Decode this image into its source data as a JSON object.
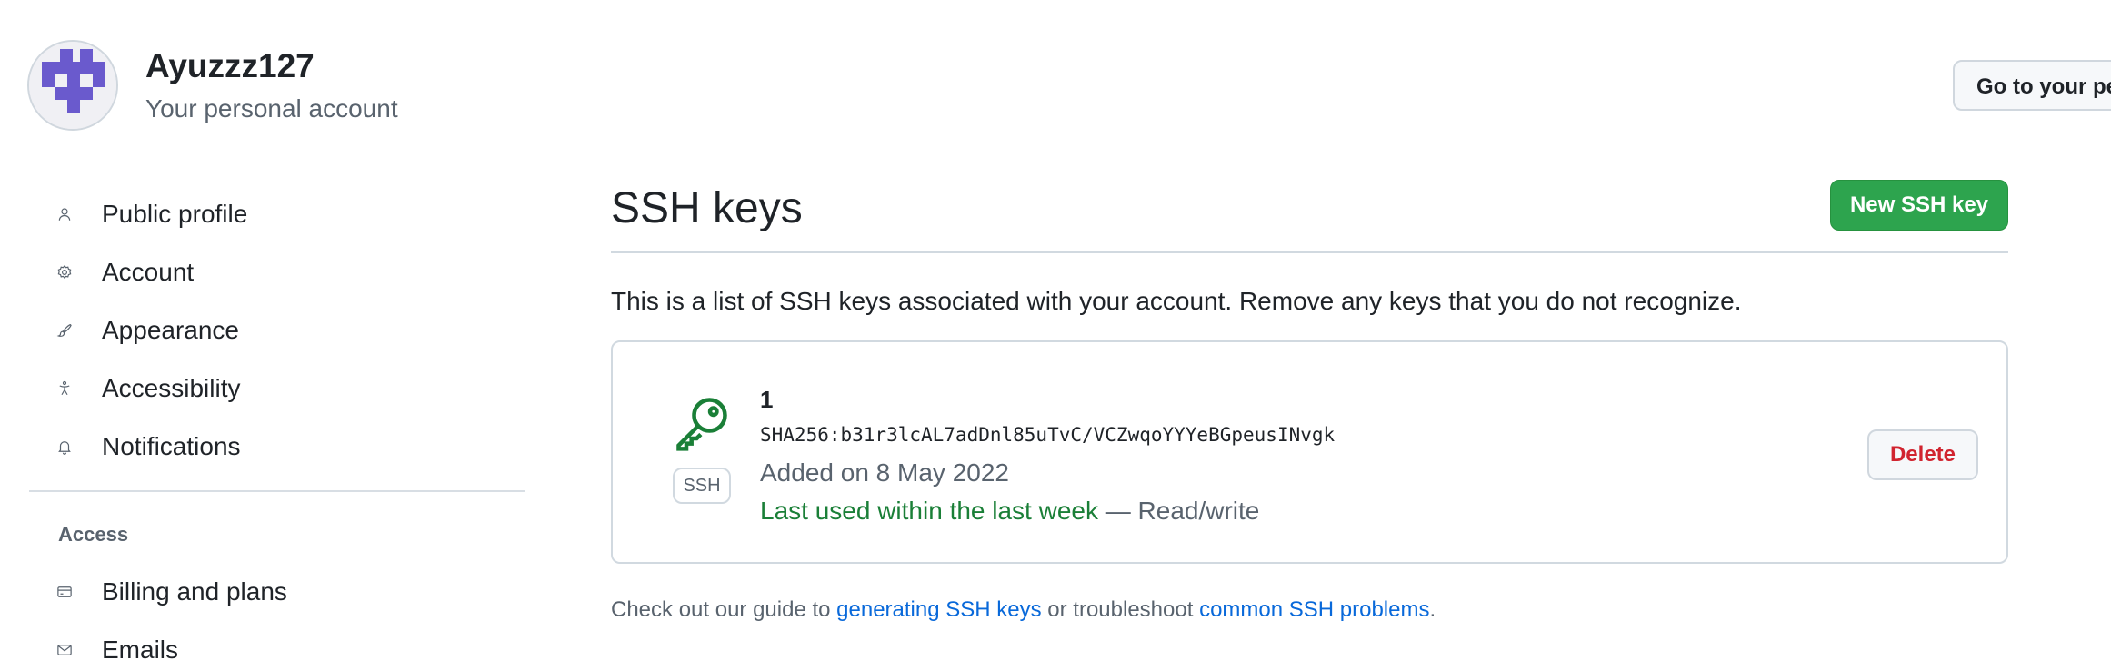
{
  "account": {
    "name": "Ayuzzz127",
    "subtitle": "Your personal account",
    "goto_button": "Go to your pe"
  },
  "sidebar": {
    "items": [
      {
        "label": "Public profile",
        "icon": "person-icon"
      },
      {
        "label": "Account",
        "icon": "gear-icon"
      },
      {
        "label": "Appearance",
        "icon": "paintbrush-icon"
      },
      {
        "label": "Accessibility",
        "icon": "accessibility-icon"
      },
      {
        "label": "Notifications",
        "icon": "bell-icon"
      }
    ],
    "section_access": "Access",
    "access_items": [
      {
        "label": "Billing and plans",
        "icon": "credit-card-icon"
      },
      {
        "label": "Emails",
        "icon": "mail-icon"
      }
    ]
  },
  "main": {
    "title": "SSH keys",
    "new_key_button": "New SSH key",
    "description": "This is a list of SSH keys associated with your account. Remove any keys that you do not recognize.",
    "key": {
      "title": "1",
      "fingerprint": "SHA256:b31r3lcAL7adDnl85uTvC/VCZwqoYYYeBGpeusINvgk",
      "added": "Added on 8 May 2022",
      "last_used": "Last used within the last week",
      "access": " — Read/write",
      "badge": "SSH",
      "delete_button": "Delete"
    },
    "guide": {
      "prefix": "Check out our guide to ",
      "link1": "generating SSH keys",
      "middle": " or troubleshoot ",
      "link2": "common SSH problems",
      "suffix": "."
    }
  },
  "colors": {
    "primary_button": "#2da44e",
    "danger": "#d1242f",
    "success_text": "#1a7f37",
    "link": "#0969da",
    "avatar_identicon": "#6a5acd"
  }
}
